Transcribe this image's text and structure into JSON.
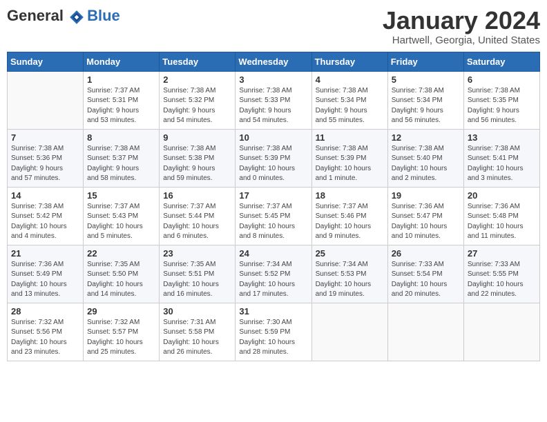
{
  "header": {
    "logo_line1": "General",
    "logo_line2": "Blue",
    "month_title": "January 2024",
    "location": "Hartwell, Georgia, United States"
  },
  "weekdays": [
    "Sunday",
    "Monday",
    "Tuesday",
    "Wednesday",
    "Thursday",
    "Friday",
    "Saturday"
  ],
  "weeks": [
    [
      {
        "day": "",
        "info": ""
      },
      {
        "day": "1",
        "info": "Sunrise: 7:37 AM\nSunset: 5:31 PM\nDaylight: 9 hours\nand 53 minutes."
      },
      {
        "day": "2",
        "info": "Sunrise: 7:38 AM\nSunset: 5:32 PM\nDaylight: 9 hours\nand 54 minutes."
      },
      {
        "day": "3",
        "info": "Sunrise: 7:38 AM\nSunset: 5:33 PM\nDaylight: 9 hours\nand 54 minutes."
      },
      {
        "day": "4",
        "info": "Sunrise: 7:38 AM\nSunset: 5:34 PM\nDaylight: 9 hours\nand 55 minutes."
      },
      {
        "day": "5",
        "info": "Sunrise: 7:38 AM\nSunset: 5:34 PM\nDaylight: 9 hours\nand 56 minutes."
      },
      {
        "day": "6",
        "info": "Sunrise: 7:38 AM\nSunset: 5:35 PM\nDaylight: 9 hours\nand 56 minutes."
      }
    ],
    [
      {
        "day": "7",
        "info": "Sunrise: 7:38 AM\nSunset: 5:36 PM\nDaylight: 9 hours\nand 57 minutes."
      },
      {
        "day": "8",
        "info": "Sunrise: 7:38 AM\nSunset: 5:37 PM\nDaylight: 9 hours\nand 58 minutes."
      },
      {
        "day": "9",
        "info": "Sunrise: 7:38 AM\nSunset: 5:38 PM\nDaylight: 9 hours\nand 59 minutes."
      },
      {
        "day": "10",
        "info": "Sunrise: 7:38 AM\nSunset: 5:39 PM\nDaylight: 10 hours\nand 0 minutes."
      },
      {
        "day": "11",
        "info": "Sunrise: 7:38 AM\nSunset: 5:39 PM\nDaylight: 10 hours\nand 1 minute."
      },
      {
        "day": "12",
        "info": "Sunrise: 7:38 AM\nSunset: 5:40 PM\nDaylight: 10 hours\nand 2 minutes."
      },
      {
        "day": "13",
        "info": "Sunrise: 7:38 AM\nSunset: 5:41 PM\nDaylight: 10 hours\nand 3 minutes."
      }
    ],
    [
      {
        "day": "14",
        "info": "Sunrise: 7:38 AM\nSunset: 5:42 PM\nDaylight: 10 hours\nand 4 minutes."
      },
      {
        "day": "15",
        "info": "Sunrise: 7:37 AM\nSunset: 5:43 PM\nDaylight: 10 hours\nand 5 minutes."
      },
      {
        "day": "16",
        "info": "Sunrise: 7:37 AM\nSunset: 5:44 PM\nDaylight: 10 hours\nand 6 minutes."
      },
      {
        "day": "17",
        "info": "Sunrise: 7:37 AM\nSunset: 5:45 PM\nDaylight: 10 hours\nand 8 minutes."
      },
      {
        "day": "18",
        "info": "Sunrise: 7:37 AM\nSunset: 5:46 PM\nDaylight: 10 hours\nand 9 minutes."
      },
      {
        "day": "19",
        "info": "Sunrise: 7:36 AM\nSunset: 5:47 PM\nDaylight: 10 hours\nand 10 minutes."
      },
      {
        "day": "20",
        "info": "Sunrise: 7:36 AM\nSunset: 5:48 PM\nDaylight: 10 hours\nand 11 minutes."
      }
    ],
    [
      {
        "day": "21",
        "info": "Sunrise: 7:36 AM\nSunset: 5:49 PM\nDaylight: 10 hours\nand 13 minutes."
      },
      {
        "day": "22",
        "info": "Sunrise: 7:35 AM\nSunset: 5:50 PM\nDaylight: 10 hours\nand 14 minutes."
      },
      {
        "day": "23",
        "info": "Sunrise: 7:35 AM\nSunset: 5:51 PM\nDaylight: 10 hours\nand 16 minutes."
      },
      {
        "day": "24",
        "info": "Sunrise: 7:34 AM\nSunset: 5:52 PM\nDaylight: 10 hours\nand 17 minutes."
      },
      {
        "day": "25",
        "info": "Sunrise: 7:34 AM\nSunset: 5:53 PM\nDaylight: 10 hours\nand 19 minutes."
      },
      {
        "day": "26",
        "info": "Sunrise: 7:33 AM\nSunset: 5:54 PM\nDaylight: 10 hours\nand 20 minutes."
      },
      {
        "day": "27",
        "info": "Sunrise: 7:33 AM\nSunset: 5:55 PM\nDaylight: 10 hours\nand 22 minutes."
      }
    ],
    [
      {
        "day": "28",
        "info": "Sunrise: 7:32 AM\nSunset: 5:56 PM\nDaylight: 10 hours\nand 23 minutes."
      },
      {
        "day": "29",
        "info": "Sunrise: 7:32 AM\nSunset: 5:57 PM\nDaylight: 10 hours\nand 25 minutes."
      },
      {
        "day": "30",
        "info": "Sunrise: 7:31 AM\nSunset: 5:58 PM\nDaylight: 10 hours\nand 26 minutes."
      },
      {
        "day": "31",
        "info": "Sunrise: 7:30 AM\nSunset: 5:59 PM\nDaylight: 10 hours\nand 28 minutes."
      },
      {
        "day": "",
        "info": ""
      },
      {
        "day": "",
        "info": ""
      },
      {
        "day": "",
        "info": ""
      }
    ]
  ]
}
